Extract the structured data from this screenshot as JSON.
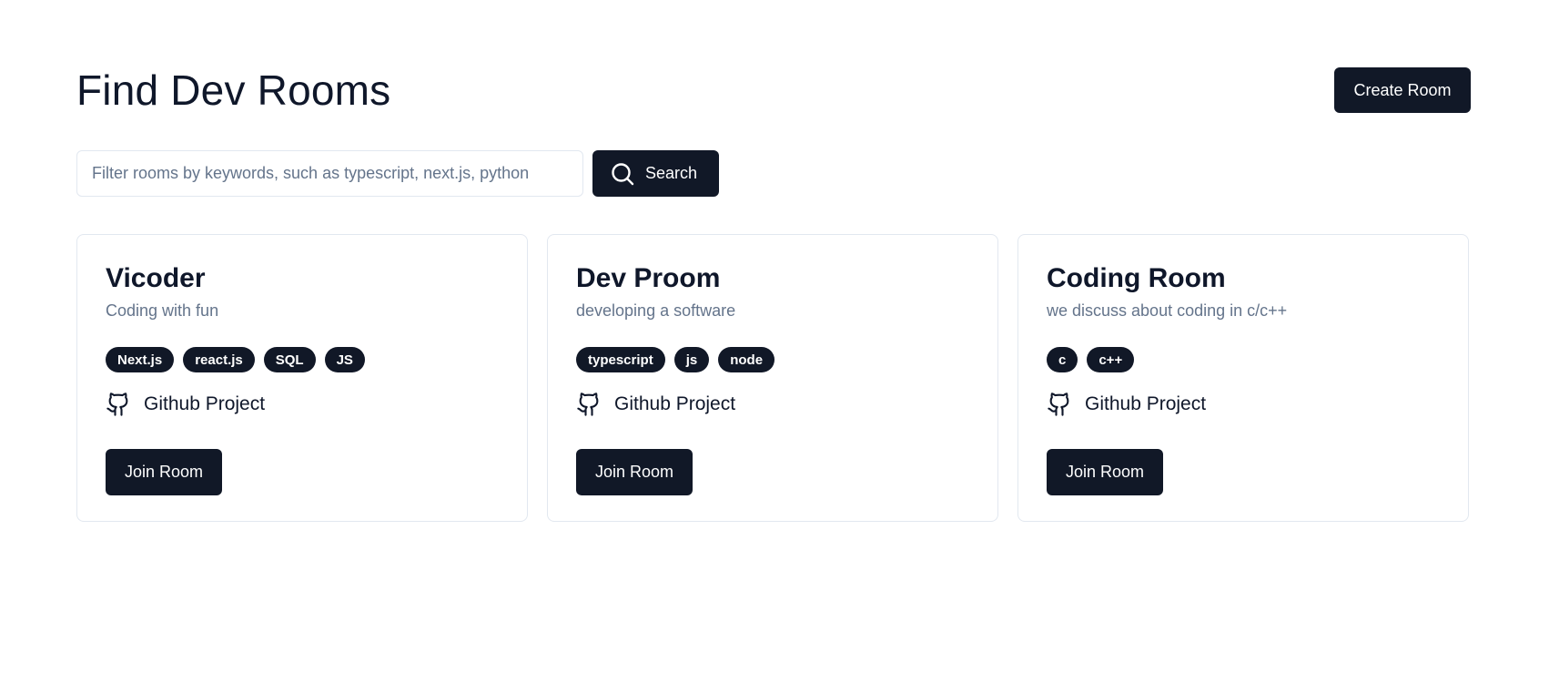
{
  "header": {
    "title": "Find Dev Rooms",
    "create_label": "Create Room"
  },
  "search": {
    "placeholder": "Filter rooms by keywords, such as typescript, next.js, python",
    "value": "",
    "button_label": "Search",
    "icon": "search-icon"
  },
  "rooms": [
    {
      "name": "Vicoder",
      "description": "Coding with fun",
      "tags": [
        "Next.js",
        "react.js",
        "SQL",
        "JS"
      ],
      "github_label": "Github Project",
      "join_label": "Join Room"
    },
    {
      "name": "Dev Proom",
      "description": "developing a software",
      "tags": [
        "typescript",
        "js",
        "node"
      ],
      "github_label": "Github Project",
      "join_label": "Join Room"
    },
    {
      "name": "Coding Room",
      "description": "we discuss about coding in c/c++",
      "tags": [
        "c",
        "c++"
      ],
      "github_label": "Github Project",
      "join_label": "Join Room"
    }
  ],
  "colors": {
    "primary": "#111827",
    "text": "#0f172a",
    "muted": "#64748b",
    "border": "#e2e8f0",
    "background": "#ffffff"
  }
}
